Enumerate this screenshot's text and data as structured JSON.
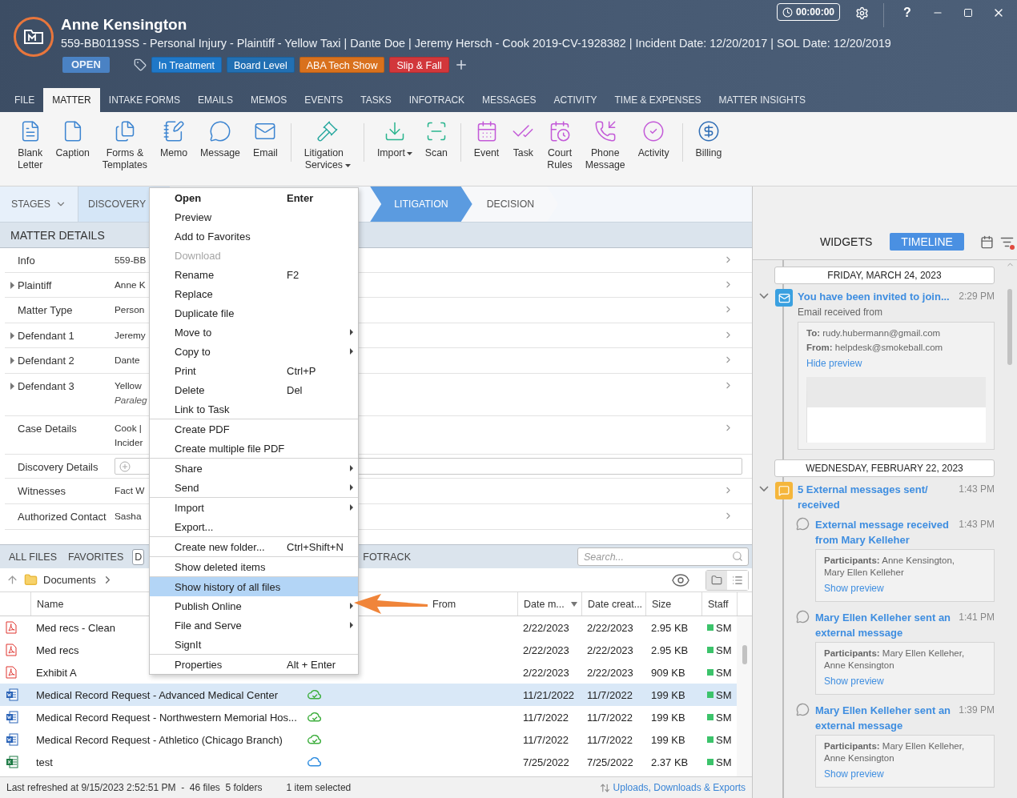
{
  "header": {
    "name": "Anne Kensington",
    "summary": "559-BB0119SS - Personal Injury - Plaintiff - Yellow Taxi | Dante Doe | Jeremy Hersch - Cook 2019-CV-1928382 | Incident Date: 12/20/2017 | SOL Date: 12/20/2019",
    "status": "OPEN",
    "timer": "00:00:00",
    "help": "?",
    "tags": [
      {
        "label": "In Treatment",
        "color": "#1f78c8"
      },
      {
        "label": "Board Level",
        "color": "#2270b3"
      },
      {
        "label": "ABA Tech Show",
        "color": "#d9711d"
      },
      {
        "label": "Slip & Fall",
        "color": "#d2373b"
      }
    ]
  },
  "tabs": [
    {
      "label": "FILE",
      "selected": false
    },
    {
      "label": "MATTER",
      "selected": true
    },
    {
      "label": "INTAKE FORMS",
      "selected": false
    },
    {
      "label": "EMAILS",
      "selected": false
    },
    {
      "label": "MEMOS",
      "selected": false
    },
    {
      "label": "EVENTS",
      "selected": false
    },
    {
      "label": "TASKS",
      "selected": false
    },
    {
      "label": "INFOTRACK",
      "selected": false
    },
    {
      "label": "MESSAGES",
      "selected": false
    },
    {
      "label": "ACTIVITY",
      "selected": false
    },
    {
      "label": "TIME & EXPENSES",
      "selected": false
    },
    {
      "label": "MATTER INSIGHTS",
      "selected": false
    }
  ],
  "ribbon": [
    {
      "items": [
        {
          "label": "Blank\nLetter",
          "color": "#3d85d1",
          "dropdown": false
        },
        {
          "label": "Caption",
          "color": "#3d85d1",
          "dropdown": false
        },
        {
          "label": "Forms &\nTemplates",
          "color": "#3d85d1",
          "dropdown": false
        },
        {
          "label": "Memo",
          "color": "#3d85d1",
          "dropdown": false
        },
        {
          "label": "Message",
          "color": "#3d85d1",
          "dropdown": false
        },
        {
          "label": "Email",
          "color": "#3d85d1",
          "dropdown": false
        }
      ]
    },
    {
      "items": [
        {
          "label": "Litigation\nServices",
          "color": "#2aa9a0",
          "dropdown": true
        }
      ]
    },
    {
      "items": [
        {
          "label": "Import",
          "color": "#2bb58f",
          "dropdown": true
        },
        {
          "label": "Scan",
          "color": "#2bb58f",
          "dropdown": false
        }
      ]
    },
    {
      "items": [
        {
          "label": "Event",
          "color": "#c35ad8",
          "dropdown": false
        },
        {
          "label": "Task",
          "color": "#c35ad8",
          "dropdown": false
        },
        {
          "label": "Court\nRules",
          "color": "#c35ad8",
          "dropdown": false
        },
        {
          "label": "Phone\nMessage",
          "color": "#c35ad8",
          "dropdown": false
        },
        {
          "label": "Activity",
          "color": "#c35ad8",
          "dropdown": false
        }
      ]
    },
    {
      "items": [
        {
          "label": "Billing",
          "color": "#2f6db5",
          "dropdown": false
        }
      ]
    }
  ],
  "stages": {
    "label": "STAGES",
    "items": [
      {
        "label": "DISCOVERY",
        "selected": false
      },
      {
        "label": "LITIGATION",
        "selected": true
      },
      {
        "label": "DECISION",
        "selected": false
      }
    ]
  },
  "matter_details": {
    "title": "MATTER DETAILS",
    "rows": [
      {
        "kind": "text",
        "label": "Info",
        "value": "559-BB",
        "expandable": false
      },
      {
        "kind": "text",
        "label": "Plaintiff",
        "value": "Anne K",
        "expandable": true
      },
      {
        "kind": "text",
        "label": "Matter Type",
        "value": "Person",
        "expandable": false
      },
      {
        "kind": "text",
        "label": "Defendant 1",
        "value": "Jeremy",
        "expandable": true
      },
      {
        "kind": "text",
        "label": "Defendant 2",
        "value": "Dante",
        "expandable": true
      },
      {
        "kind": "text",
        "label": "Defendant 3",
        "value": "Yellow",
        "note": "Paraleg",
        "expandable": true
      },
      {
        "kind": "text",
        "label": "Case Details",
        "value": "Cook |",
        "value_2": "Incider",
        "expandable": false
      },
      {
        "kind": "field",
        "label": "Discovery Details",
        "expandable": false
      },
      {
        "kind": "text",
        "label": "Witnesses",
        "value": "Fact W",
        "expandable": false
      },
      {
        "kind": "text",
        "label": "Authorized Contact",
        "value": "Sasha",
        "expandable": false
      }
    ]
  },
  "files": {
    "tabs": [
      {
        "label": "ALL FILES",
        "selected": false
      },
      {
        "label": "FAVORITES",
        "selected": false
      },
      {
        "label": "D",
        "selected": true
      },
      {
        "label": "FOTRACK",
        "selected": false
      }
    ],
    "search": {
      "placeholder": "Search..."
    },
    "breadcrumb": "Documents",
    "views": [
      {
        "selected": true
      },
      {
        "selected": false
      }
    ],
    "columns": [
      "Name",
      "From",
      "Date m...",
      "Date creat...",
      "Size",
      "Staff"
    ],
    "rows": [
      {
        "kind": "pdf",
        "name": "Med recs - Clean",
        "modified": "2/22/2023",
        "created": "2/22/2023",
        "size": "2.95 KB",
        "staff": "SM",
        "selected": false
      },
      {
        "kind": "pdf",
        "name": "Med recs",
        "modified": "2/22/2023",
        "created": "2/22/2023",
        "size": "2.95 KB",
        "staff": "SM",
        "selected": false
      },
      {
        "kind": "pdf",
        "name": "Exhibit A",
        "modified": "2/22/2023",
        "created": "2/22/2023",
        "size": "909 KB",
        "staff": "SM",
        "selected": false
      },
      {
        "kind": "doc",
        "name": "Medical Record Request - Advanced Medical Center",
        "sync_icon": {
          "kind": "synced"
        },
        "modified": "11/21/2022",
        "created": "11/7/2022",
        "size": "199 KB",
        "staff": "SM",
        "selected": true
      },
      {
        "kind": "doc",
        "name": "Medical Record Request - Northwestern Memorial Hos...",
        "sync_icon": {
          "kind": "synced"
        },
        "modified": "11/7/2022",
        "created": "11/7/2022",
        "size": "199 KB",
        "staff": "SM",
        "selected": false
      },
      {
        "kind": "doc",
        "name": "Medical Record Request - Athletico (Chicago Branch)",
        "sync_icon": {
          "kind": "synced"
        },
        "modified": "11/7/2022",
        "created": "11/7/2022",
        "size": "199 KB",
        "staff": "SM",
        "selected": false
      },
      {
        "kind": "xls",
        "name": "test",
        "sync_icon": {
          "kind": "cloud"
        },
        "modified": "7/25/2022",
        "created": "7/25/2022",
        "size": "2.37 KB",
        "staff": "SM",
        "selected": false
      }
    ],
    "status": "Last refreshed at 9/15/2023 2:52:51 PM  -  46 files  5 folders",
    "selection": "1 item selected",
    "transfers": "Uploads, Downloads & Exports"
  },
  "menu": {
    "items": [
      {
        "label": "Open",
        "shortcut": "Enter",
        "default": true,
        "submenu": false,
        "disabled": false,
        "selected": false,
        "separator_before": false
      },
      {
        "label": "Preview",
        "default": false,
        "submenu": false,
        "disabled": false,
        "selected": false,
        "separator_before": false
      },
      {
        "label": "Add to Favorites",
        "default": false,
        "submenu": false,
        "disabled": false,
        "selected": false,
        "separator_before": false
      },
      {
        "label": "Download",
        "default": false,
        "submenu": false,
        "disabled": true,
        "selected": false,
        "separator_before": false
      },
      {
        "label": "Rename",
        "shortcut": "F2",
        "default": false,
        "submenu": false,
        "disabled": false,
        "selected": false,
        "separator_before": false
      },
      {
        "label": "Replace",
        "default": false,
        "submenu": false,
        "disabled": false,
        "selected": false,
        "separator_before": false
      },
      {
        "label": "Duplicate file",
        "default": false,
        "submenu": false,
        "disabled": false,
        "selected": false,
        "separator_before": false
      },
      {
        "label": "Move to",
        "default": false,
        "submenu": true,
        "disabled": false,
        "selected": false,
        "separator_before": false
      },
      {
        "label": "Copy to",
        "default": false,
        "submenu": true,
        "disabled": false,
        "selected": false,
        "separator_before": false
      },
      {
        "label": "Print",
        "shortcut": "Ctrl+P",
        "default": false,
        "submenu": false,
        "disabled": false,
        "selected": false,
        "separator_before": false
      },
      {
        "label": "Delete",
        "shortcut": "Del",
        "default": false,
        "submenu": false,
        "disabled": false,
        "selected": false,
        "separator_before": false
      },
      {
        "label": "Link to Task",
        "default": false,
        "submenu": false,
        "disabled": false,
        "selected": false,
        "separator_before": false
      },
      {
        "label": "Create PDF",
        "default": false,
        "submenu": false,
        "disabled": false,
        "selected": false,
        "separator_before": true
      },
      {
        "label": "Create multiple file PDF",
        "default": false,
        "submenu": false,
        "disabled": false,
        "selected": false,
        "separator_before": false
      },
      {
        "label": "Share",
        "default": false,
        "submenu": true,
        "disabled": false,
        "selected": false,
        "separator_before": true
      },
      {
        "label": "Send",
        "default": false,
        "submenu": true,
        "disabled": false,
        "selected": false,
        "separator_before": false
      },
      {
        "label": "Import",
        "default": false,
        "submenu": true,
        "disabled": false,
        "selected": false,
        "separator_before": true
      },
      {
        "label": "Export...",
        "default": false,
        "submenu": false,
        "disabled": false,
        "selected": false,
        "separator_before": false
      },
      {
        "label": "Create new folder...",
        "shortcut": "Ctrl+Shift+N",
        "default": false,
        "submenu": false,
        "disabled": false,
        "selected": false,
        "separator_before": true
      },
      {
        "label": "Show deleted items",
        "default": false,
        "submenu": false,
        "disabled": false,
        "selected": false,
        "separator_before": true
      },
      {
        "label": "Show history of all files",
        "default": false,
        "submenu": false,
        "disabled": false,
        "selected": true,
        "separator_before": true
      },
      {
        "label": "Publish Online",
        "default": false,
        "submenu": true,
        "disabled": false,
        "selected": false,
        "separator_before": false
      },
      {
        "label": "File and Serve",
        "default": false,
        "submenu": true,
        "disabled": false,
        "selected": false,
        "separator_before": false
      },
      {
        "label": "SignIt",
        "default": false,
        "submenu": false,
        "disabled": false,
        "selected": false,
        "separator_before": false
      },
      {
        "label": "Properties",
        "shortcut": "Alt + Enter",
        "default": false,
        "submenu": false,
        "disabled": false,
        "selected": false,
        "separator_before": true
      }
    ]
  },
  "timeline": {
    "tabs": [
      {
        "label": "WIDGETS",
        "selected": false
      },
      {
        "label": "TIMELINE",
        "selected": true
      }
    ],
    "days": [
      {
        "date": "FRIDAY, MARCH 24, 2023",
        "events": [
          {
            "kind": "email",
            "expanded": true,
            "title": "You have been invited to join...",
            "time": "2:29 PM",
            "subtitle": "Email received from",
            "details": [
              "**To:** rudy.hubermann@gmail.com",
              "**From:** helpdesk@smokeball.com"
            ],
            "link": "Hide preview"
          }
        ]
      },
      {
        "date": "WEDNESDAY, FEBRUARY 22, 2023",
        "events": [
          {
            "kind": "group",
            "expanded": true,
            "title": "5 External messages sent/ received",
            "time": "1:43 PM",
            "children": [
              {
                "title": "External message received from Mary Kelleher",
                "time": "1:43 PM",
                "details": [
                  "**Participants:** Anne Kensington, Mary Ellen Kelleher"
                ],
                "link": "Show preview"
              },
              {
                "title": "Mary Ellen Kelleher sent an external message",
                "time": "1:41 PM",
                "details": [
                  "**Participants:** Mary Ellen Kelleher, Anne Kensington"
                ],
                "link": "Show preview"
              },
              {
                "title": "Mary Ellen Kelleher sent an external message",
                "time": "1:39 PM",
                "details": [
                  "**Participants:** Mary Ellen Kelleher, Anne Kensington"
                ],
                "link": "Show preview"
              }
            ]
          }
        ]
      }
    ]
  }
}
